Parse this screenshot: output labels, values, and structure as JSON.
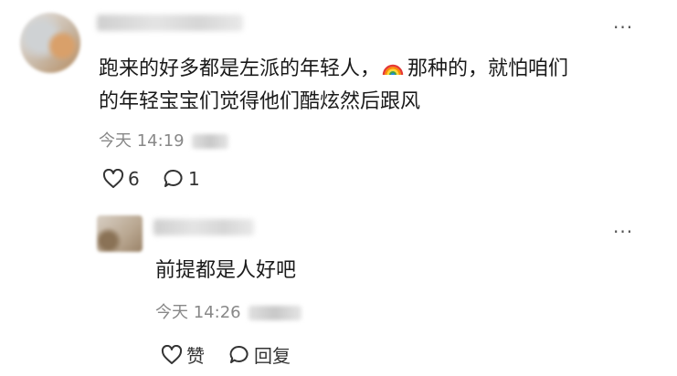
{
  "comments": [
    {
      "text_line1": "跑来的好多都是左派的年轻人，",
      "emoji": "rainbow-flag",
      "text_line1b": "那种的，就怕咱们",
      "text_line2": "的年轻宝宝们觉得他们酷炫然后跟风",
      "time": "今天 14:19",
      "like_count": "6",
      "reply_count": "1"
    },
    {
      "text": "前提都是人好吧",
      "time": "今天 14:26",
      "like_label": "赞",
      "reply_label": "回复"
    }
  ],
  "more_glyph": "···",
  "colors": {
    "text": "#1a1a1a",
    "meta": "#888888",
    "action": "#333333"
  }
}
